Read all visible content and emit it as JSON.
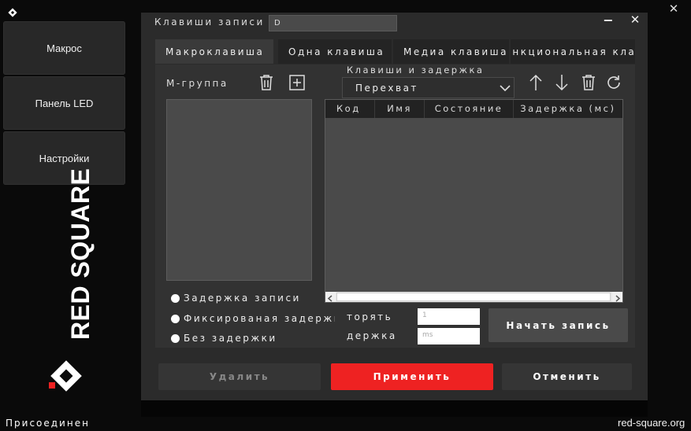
{
  "app": {
    "close_glyph": "✕",
    "status": "Присоединен",
    "website": "red-square.org",
    "brand": "RED SQUARE",
    "colors": {
      "background": "#0a0a0a",
      "accent": "#ee2222",
      "panel": "#2b2b2b"
    }
  },
  "sidebar": {
    "items": [
      {
        "label": "Макрос"
      },
      {
        "label": "Панель LED"
      },
      {
        "label": "Настройки"
      }
    ]
  },
  "dialog": {
    "record_keys_label": "Клавиши записи",
    "record_keys_value": "D",
    "minimize_glyph": "−",
    "close_glyph": "✕",
    "tabs": [
      {
        "label": "Макроклавиша"
      },
      {
        "label": "Одна клавиша"
      },
      {
        "label": "Медиа клавиша"
      },
      {
        "label": "Функциональная клав"
      }
    ],
    "mgroup_label": "М-группа",
    "keys_delay_label": "Клавиши и задержка",
    "capture_select": "Перехват",
    "table": {
      "headers": [
        "Код",
        "Имя",
        "Состояние",
        "Задержка (мс)"
      ]
    },
    "delay_options": [
      {
        "label": "Задержка записи"
      },
      {
        "label": "Фиксированая задержка"
      },
      {
        "label": "Без задержки"
      }
    ],
    "repeat_label": "торять",
    "repeat_value": "1",
    "hold_label": "держка",
    "hold_placeholder": "ms",
    "start_record": "Начать запись",
    "buttons": {
      "delete": "Удалить",
      "apply": "Применить",
      "cancel": "Отменить"
    }
  }
}
